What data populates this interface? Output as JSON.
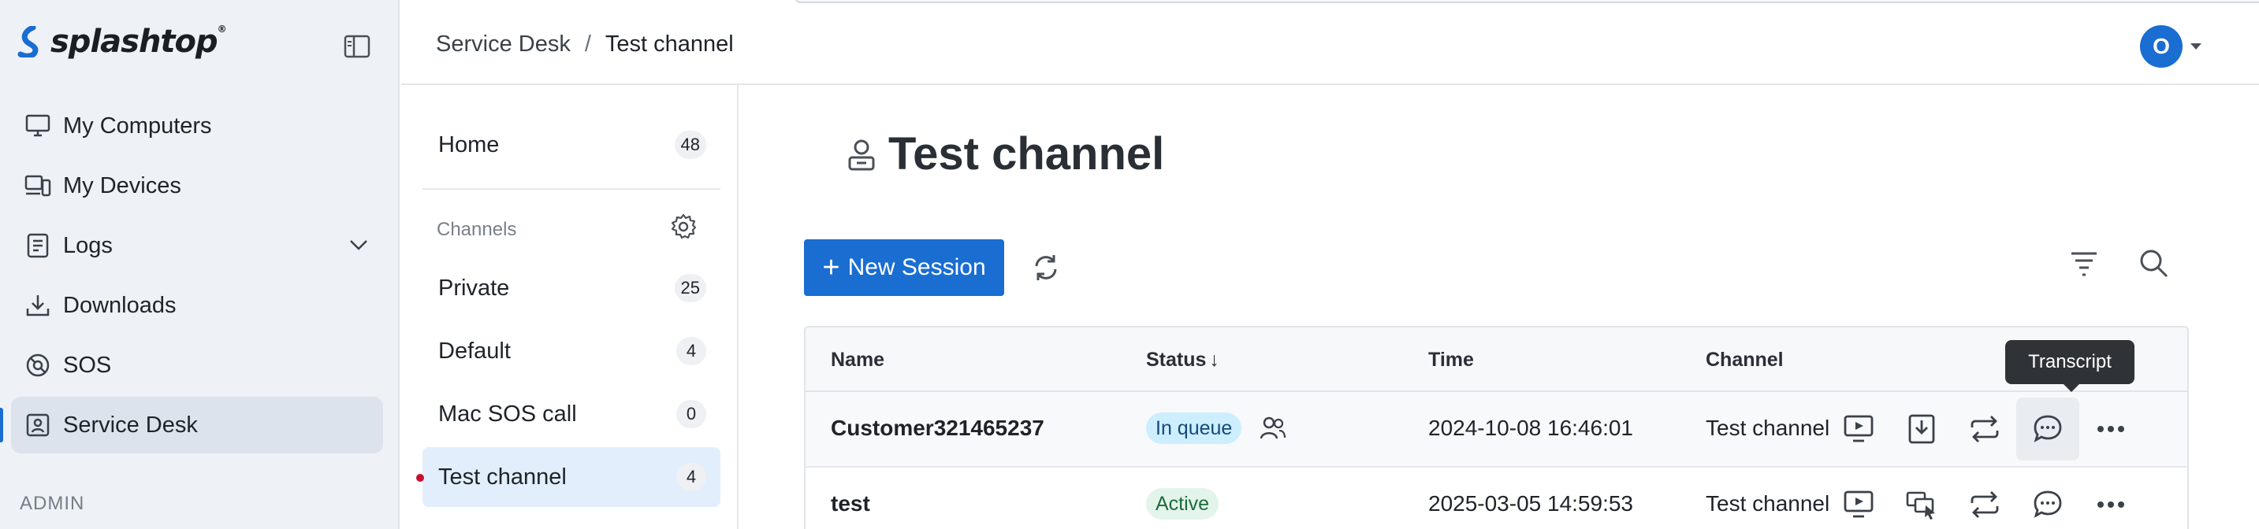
{
  "brand": {
    "name": "splashtop",
    "trademark": "®"
  },
  "sidebar": {
    "items": [
      {
        "label": "My Computers",
        "icon": "monitor-icon"
      },
      {
        "label": "My Devices",
        "icon": "devices-icon"
      },
      {
        "label": "Logs",
        "icon": "logs-icon"
      },
      {
        "label": "Downloads",
        "icon": "download-icon"
      },
      {
        "label": "SOS",
        "icon": "sos-icon"
      },
      {
        "label": "Service Desk",
        "icon": "service-desk-icon",
        "active": true
      }
    ],
    "section_label": "ADMIN"
  },
  "header": {
    "breadcrumb": {
      "root": "Service Desk",
      "separator": "/",
      "current": "Test channel"
    },
    "avatar_initial": "O"
  },
  "channels": {
    "home": {
      "label": "Home",
      "count": "48"
    },
    "section_title": "Channels",
    "items": [
      {
        "label": "Private",
        "count": "25"
      },
      {
        "label": "Default",
        "count": "4"
      },
      {
        "label": "Mac SOS call",
        "count": "0"
      },
      {
        "label": "Test channel",
        "count": "4",
        "active": true
      }
    ]
  },
  "main": {
    "title": "Test channel",
    "new_session_label": "New Session",
    "table": {
      "columns": {
        "name": "Name",
        "status": "Status",
        "status_sort": "↓",
        "time": "Time",
        "channel": "Channel"
      },
      "rows": [
        {
          "name": "Customer321465237",
          "status": "In queue",
          "time": "2024-10-08 16:46:01",
          "channel": "Test channel"
        },
        {
          "name": "test",
          "status": "Active",
          "time": "2025-03-05 14:59:53",
          "channel": "Test channel"
        }
      ]
    },
    "tooltip": "Transcript"
  },
  "colors": {
    "accent": "#1a6dd1",
    "queue_badge": "#cdeeff",
    "active_badge": "#e3f5ea",
    "sidebar_bg": "#eef2f7"
  }
}
